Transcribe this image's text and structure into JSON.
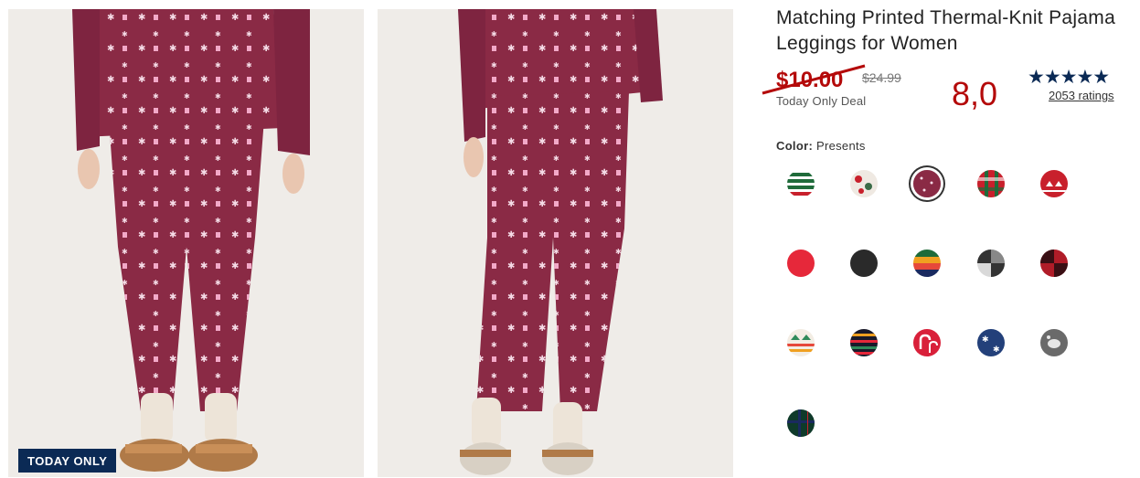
{
  "badge": {
    "label": "TODAY ONLY"
  },
  "product": {
    "title": "Matching Printed Thermal-Knit Pajama Leggings for Women",
    "sale_price": "$10.00",
    "regular_price": "$24.99",
    "deal_label": "Today Only Deal",
    "score": "8,0",
    "ratings_label": "2053 ratings",
    "stars": "★★★★★",
    "star_rating": 4.5
  },
  "color": {
    "label": "Color:",
    "selected": "Presents",
    "swatches": [
      {
        "name": "green-white-red-stripe",
        "row": 0,
        "col": 0
      },
      {
        "name": "holiday-white-print",
        "row": 0,
        "col": 1
      },
      {
        "name": "presents",
        "row": 0,
        "col": 2,
        "selected": true
      },
      {
        "name": "red-plaid",
        "row": 0,
        "col": 3
      },
      {
        "name": "red-fair-isle",
        "row": 0,
        "col": 4
      },
      {
        "name": "solid-red",
        "row": 1,
        "col": 0
      },
      {
        "name": "solid-black",
        "row": 1,
        "col": 1
      },
      {
        "name": "multi-stripe",
        "row": 1,
        "col": 2
      },
      {
        "name": "gray-buffalo-check",
        "row": 1,
        "col": 3
      },
      {
        "name": "red-buffalo-check",
        "row": 1,
        "col": 4
      },
      {
        "name": "fair-isle-multi",
        "row": 2,
        "col": 0
      },
      {
        "name": "dark-stripe",
        "row": 2,
        "col": 1
      },
      {
        "name": "candy-cane",
        "row": 2,
        "col": 2
      },
      {
        "name": "navy-snowflake",
        "row": 2,
        "col": 3
      },
      {
        "name": "gray-print",
        "row": 2,
        "col": 4
      },
      {
        "name": "green-tartan",
        "row": 3,
        "col": 0
      }
    ]
  },
  "colors": {
    "accent_red": "#b40a0a",
    "navy": "#0b2a55",
    "legging": "#8a2a45"
  }
}
